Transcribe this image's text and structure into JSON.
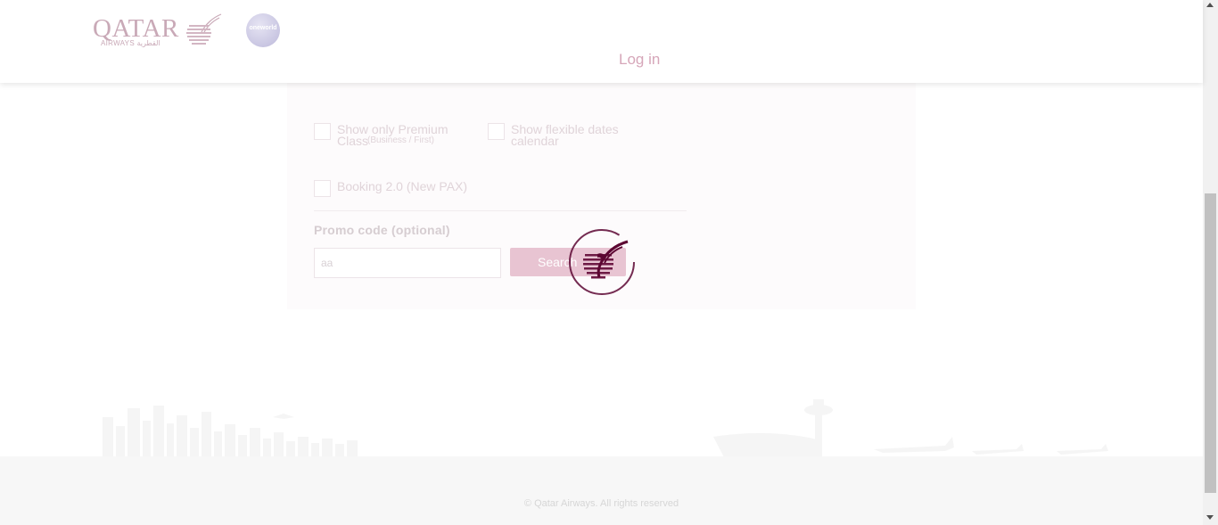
{
  "header": {
    "brand": "QATAR",
    "brand_sub": "AIRWAYS القطرية",
    "alliance": "oneworld",
    "login_label": "Log in"
  },
  "filters": {
    "premium_label": "Show only Premium Class",
    "premium_sub": "(Business / First)",
    "premium_checked": false,
    "flexible_label": "Show flexible dates calendar",
    "flexible_checked": false,
    "booking_label": "Booking 2.0 (New PAX)",
    "booking_checked": false
  },
  "promo": {
    "label": "Promo code (optional)",
    "value": "aa"
  },
  "search_label": "Search",
  "footer": {
    "copyright": "© Qatar Airways. All rights reserved"
  },
  "colors": {
    "brand": "#5c0632",
    "accent_pink": "#e8c4d2"
  },
  "icons": {
    "loader": "qatar-oryx-spinner-icon",
    "logo": "qatar-oryx-logo-icon"
  }
}
